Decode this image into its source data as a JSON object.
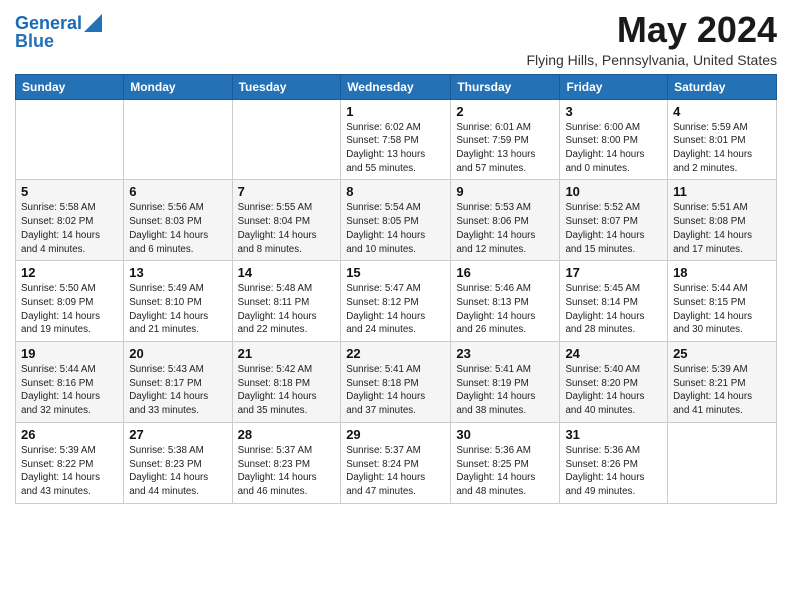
{
  "header": {
    "logo_line1": "General",
    "logo_line2": "Blue",
    "month_title": "May 2024",
    "location": "Flying Hills, Pennsylvania, United States"
  },
  "weekdays": [
    "Sunday",
    "Monday",
    "Tuesday",
    "Wednesday",
    "Thursday",
    "Friday",
    "Saturday"
  ],
  "weeks": [
    [
      {
        "day": "",
        "info": ""
      },
      {
        "day": "",
        "info": ""
      },
      {
        "day": "",
        "info": ""
      },
      {
        "day": "1",
        "info": "Sunrise: 6:02 AM\nSunset: 7:58 PM\nDaylight: 13 hours\nand 55 minutes."
      },
      {
        "day": "2",
        "info": "Sunrise: 6:01 AM\nSunset: 7:59 PM\nDaylight: 13 hours\nand 57 minutes."
      },
      {
        "day": "3",
        "info": "Sunrise: 6:00 AM\nSunset: 8:00 PM\nDaylight: 14 hours\nand 0 minutes."
      },
      {
        "day": "4",
        "info": "Sunrise: 5:59 AM\nSunset: 8:01 PM\nDaylight: 14 hours\nand 2 minutes."
      }
    ],
    [
      {
        "day": "5",
        "info": "Sunrise: 5:58 AM\nSunset: 8:02 PM\nDaylight: 14 hours\nand 4 minutes."
      },
      {
        "day": "6",
        "info": "Sunrise: 5:56 AM\nSunset: 8:03 PM\nDaylight: 14 hours\nand 6 minutes."
      },
      {
        "day": "7",
        "info": "Sunrise: 5:55 AM\nSunset: 8:04 PM\nDaylight: 14 hours\nand 8 minutes."
      },
      {
        "day": "8",
        "info": "Sunrise: 5:54 AM\nSunset: 8:05 PM\nDaylight: 14 hours\nand 10 minutes."
      },
      {
        "day": "9",
        "info": "Sunrise: 5:53 AM\nSunset: 8:06 PM\nDaylight: 14 hours\nand 12 minutes."
      },
      {
        "day": "10",
        "info": "Sunrise: 5:52 AM\nSunset: 8:07 PM\nDaylight: 14 hours\nand 15 minutes."
      },
      {
        "day": "11",
        "info": "Sunrise: 5:51 AM\nSunset: 8:08 PM\nDaylight: 14 hours\nand 17 minutes."
      }
    ],
    [
      {
        "day": "12",
        "info": "Sunrise: 5:50 AM\nSunset: 8:09 PM\nDaylight: 14 hours\nand 19 minutes."
      },
      {
        "day": "13",
        "info": "Sunrise: 5:49 AM\nSunset: 8:10 PM\nDaylight: 14 hours\nand 21 minutes."
      },
      {
        "day": "14",
        "info": "Sunrise: 5:48 AM\nSunset: 8:11 PM\nDaylight: 14 hours\nand 22 minutes."
      },
      {
        "day": "15",
        "info": "Sunrise: 5:47 AM\nSunset: 8:12 PM\nDaylight: 14 hours\nand 24 minutes."
      },
      {
        "day": "16",
        "info": "Sunrise: 5:46 AM\nSunset: 8:13 PM\nDaylight: 14 hours\nand 26 minutes."
      },
      {
        "day": "17",
        "info": "Sunrise: 5:45 AM\nSunset: 8:14 PM\nDaylight: 14 hours\nand 28 minutes."
      },
      {
        "day": "18",
        "info": "Sunrise: 5:44 AM\nSunset: 8:15 PM\nDaylight: 14 hours\nand 30 minutes."
      }
    ],
    [
      {
        "day": "19",
        "info": "Sunrise: 5:44 AM\nSunset: 8:16 PM\nDaylight: 14 hours\nand 32 minutes."
      },
      {
        "day": "20",
        "info": "Sunrise: 5:43 AM\nSunset: 8:17 PM\nDaylight: 14 hours\nand 33 minutes."
      },
      {
        "day": "21",
        "info": "Sunrise: 5:42 AM\nSunset: 8:18 PM\nDaylight: 14 hours\nand 35 minutes."
      },
      {
        "day": "22",
        "info": "Sunrise: 5:41 AM\nSunset: 8:18 PM\nDaylight: 14 hours\nand 37 minutes."
      },
      {
        "day": "23",
        "info": "Sunrise: 5:41 AM\nSunset: 8:19 PM\nDaylight: 14 hours\nand 38 minutes."
      },
      {
        "day": "24",
        "info": "Sunrise: 5:40 AM\nSunset: 8:20 PM\nDaylight: 14 hours\nand 40 minutes."
      },
      {
        "day": "25",
        "info": "Sunrise: 5:39 AM\nSunset: 8:21 PM\nDaylight: 14 hours\nand 41 minutes."
      }
    ],
    [
      {
        "day": "26",
        "info": "Sunrise: 5:39 AM\nSunset: 8:22 PM\nDaylight: 14 hours\nand 43 minutes."
      },
      {
        "day": "27",
        "info": "Sunrise: 5:38 AM\nSunset: 8:23 PM\nDaylight: 14 hours\nand 44 minutes."
      },
      {
        "day": "28",
        "info": "Sunrise: 5:37 AM\nSunset: 8:23 PM\nDaylight: 14 hours\nand 46 minutes."
      },
      {
        "day": "29",
        "info": "Sunrise: 5:37 AM\nSunset: 8:24 PM\nDaylight: 14 hours\nand 47 minutes."
      },
      {
        "day": "30",
        "info": "Sunrise: 5:36 AM\nSunset: 8:25 PM\nDaylight: 14 hours\nand 48 minutes."
      },
      {
        "day": "31",
        "info": "Sunrise: 5:36 AM\nSunset: 8:26 PM\nDaylight: 14 hours\nand 49 minutes."
      },
      {
        "day": "",
        "info": ""
      }
    ]
  ]
}
